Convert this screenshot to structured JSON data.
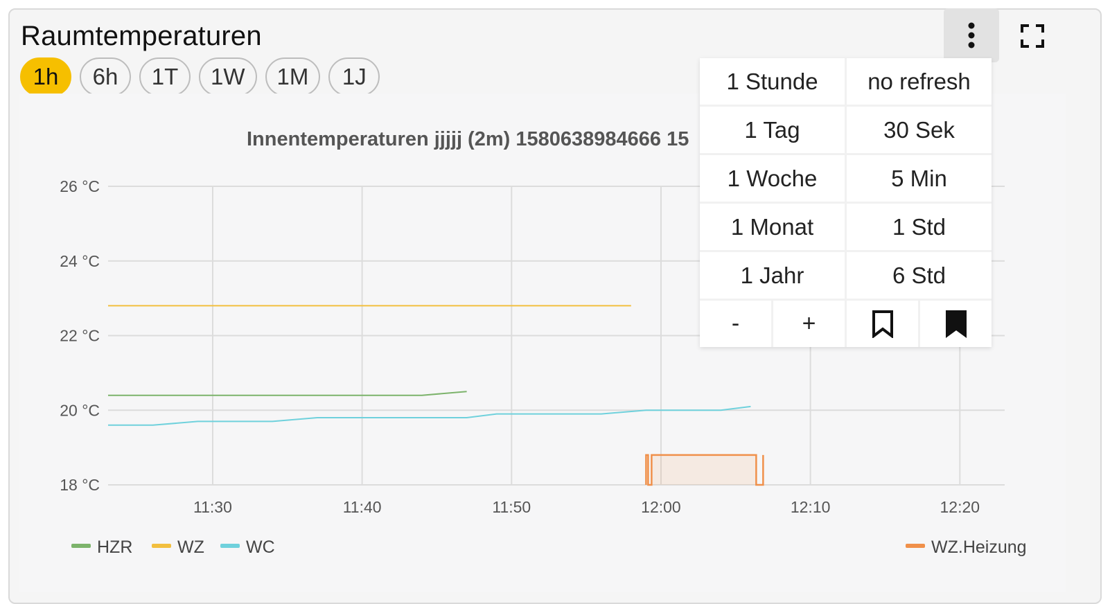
{
  "card": {
    "title": "Raumtemperaturen"
  },
  "ranges": [
    {
      "label": "1h",
      "active": true
    },
    {
      "label": "6h",
      "active": false
    },
    {
      "label": "1T",
      "active": false
    },
    {
      "label": "1W",
      "active": false
    },
    {
      "label": "1M",
      "active": false
    },
    {
      "label": "1J",
      "active": false
    }
  ],
  "icons": {
    "menu": "more-vertical-icon",
    "fullscreen": "fullscreen-icon"
  },
  "dropdown": {
    "periods": [
      "1 Stunde",
      "1 Tag",
      "1 Woche",
      "1 Monat",
      "1 Jahr"
    ],
    "refresh": [
      "no refresh",
      "30 Sek",
      "5 Min",
      "1 Std",
      "6 Std"
    ],
    "minus_label": "-",
    "plus_label": "+",
    "bookmark_icons": [
      "bookmark-outline-icon",
      "bookmark-filled-icon"
    ]
  },
  "colors": {
    "accent": "#f6bf00",
    "HZR": "#7cb36b",
    "WZ": "#f2bf3f",
    "WC": "#6fd1dc",
    "WZ.Heizung": "#f0904a"
  },
  "chart_data": {
    "type": "line",
    "title": "Innentemperaturen jjjjj (2m) 1580638984666 15",
    "y_ticks": [
      "18 °C",
      "20 °C",
      "22 °C",
      "24 °C",
      "26 °C"
    ],
    "ylim": [
      18,
      26
    ],
    "x_ticks": [
      "11:30",
      "11:40",
      "11:50",
      "12:00",
      "12:10",
      "12:20"
    ],
    "xlim": [
      "11:23",
      "12:23"
    ],
    "grid": true,
    "legend": {
      "left": [
        "HZR",
        "WZ",
        "WC"
      ],
      "right": [
        "WZ.Heizung"
      ]
    },
    "series": [
      {
        "name": "HZR",
        "x": [
          "11:23",
          "11:44",
          "11:47"
        ],
        "y": [
          20.4,
          20.4,
          20.5
        ]
      },
      {
        "name": "WZ",
        "x": [
          "11:23",
          "11:58"
        ],
        "y": [
          22.8,
          22.8
        ]
      },
      {
        "name": "WC",
        "x": [
          "11:23",
          "11:26",
          "11:29",
          "11:34",
          "11:37",
          "11:41",
          "11:44",
          "11:47",
          "11:49",
          "11:53",
          "11:56",
          "11:59",
          "12:01",
          "12:04",
          "12:06"
        ],
        "y": [
          19.6,
          19.6,
          19.7,
          19.7,
          19.8,
          19.8,
          19.8,
          19.8,
          19.9,
          19.9,
          19.9,
          20.0,
          20.0,
          20.0,
          20.1
        ]
      },
      {
        "name": "WZ.Heizung",
        "type": "area",
        "secondary_axis": true,
        "x": [
          "11:59",
          "11:59",
          "11:59",
          "11:59",
          "12:06",
          "12:06",
          "12:07",
          "12:07"
        ],
        "y": [
          0,
          1,
          1,
          1,
          1,
          0,
          0,
          1
        ]
      }
    ]
  }
}
